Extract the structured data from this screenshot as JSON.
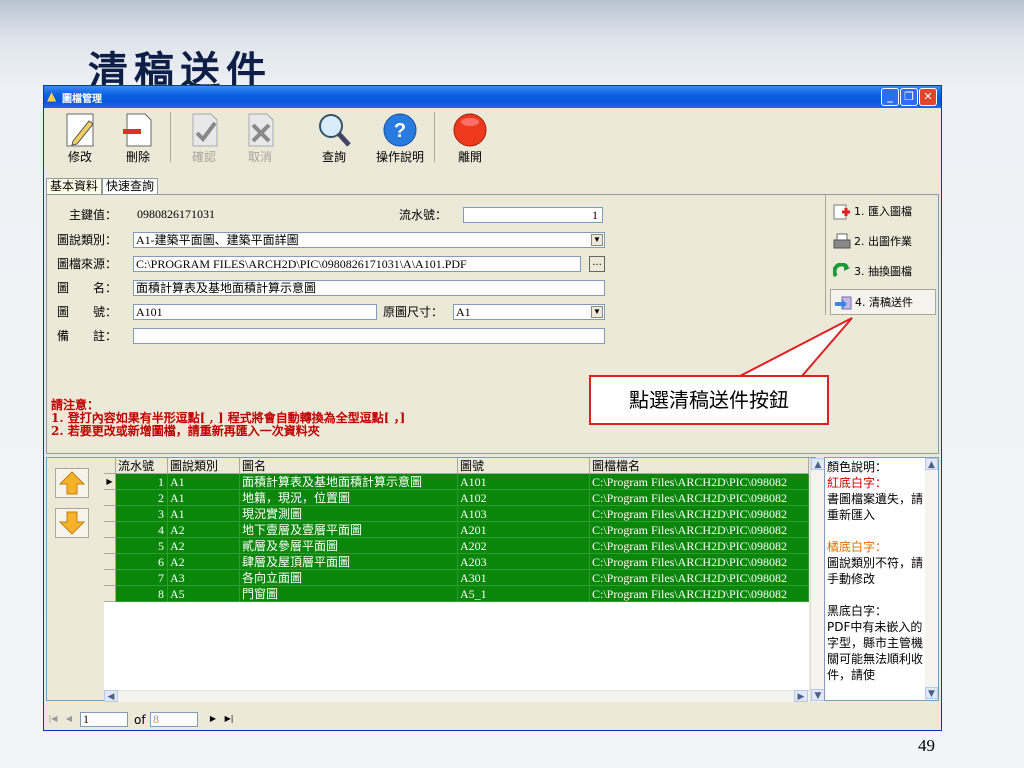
{
  "slide": {
    "title": "清稿送件",
    "page_number": "49"
  },
  "window": {
    "title": "圖檔管理"
  },
  "toolbar": {
    "buttons": [
      {
        "label": "修改",
        "icon": "pencil-icon",
        "enabled": true
      },
      {
        "label": "刪除",
        "icon": "delete-doc-icon",
        "enabled": true
      },
      {
        "label": "確認",
        "icon": "confirm-icon",
        "enabled": false
      },
      {
        "label": "取消",
        "icon": "cancel-icon",
        "enabled": false
      },
      {
        "label": "查詢",
        "icon": "magnifier-icon",
        "enabled": true
      },
      {
        "label": "操作說明",
        "icon": "help-icon",
        "enabled": true
      },
      {
        "label": "離開",
        "icon": "exit-icon",
        "enabled": true
      }
    ]
  },
  "tabs": [
    "基本資料",
    "快速查詢"
  ],
  "form": {
    "key_label": "主鍵值：",
    "key_value": "0980826171031",
    "serial_label": "流水號：",
    "serial_value": "1",
    "category_label": "圖說類別：",
    "category_value": "A1-建築平面圖、建築平面詳圖",
    "source_label": "圖檔來源：",
    "source_value": "C:\\PROGRAM FILES\\ARCH2D\\PIC\\0980826171031\\A\\A101.PDF",
    "name_label": "圖　　名：",
    "name_value": "面積計算表及基地面積計算示意圖",
    "number_label": "圖　　號：",
    "number_value": "A101",
    "size_label": "原圖尺寸：",
    "size_value": "A1",
    "note_label": "備　　註：",
    "note_value": ""
  },
  "notice": {
    "line1": "請注意：",
    "line2": "1. 登打內容如果有半形逗點[ , ]   程式將會自動轉換為全型逗點[ ，]",
    "line3": "2. 若要更改或新增圖檔，請重新再匯入一次資料夾"
  },
  "side_buttons": [
    {
      "label": "1. 匯入圖檔",
      "icon": "import-icon"
    },
    {
      "label": "2. 出圖作業",
      "icon": "printer-icon"
    },
    {
      "label": "3. 抽換圖檔",
      "icon": "swap-icon"
    },
    {
      "label": "4. 清稿送件",
      "icon": "send-icon"
    }
  ],
  "callout": {
    "text": "點選清稿送件按鈕"
  },
  "grid": {
    "headers": [
      "流水號",
      "圖說類別",
      "圖名",
      "圖號",
      "圖檔檔名"
    ],
    "rows": [
      [
        "1",
        "A1",
        "面積計算表及基地面積計算示意圖",
        "A101",
        "C:\\Program Files\\ARCH2D\\PIC\\098082"
      ],
      [
        "2",
        "A1",
        "地籍，現況，位置圖",
        "A102",
        "C:\\Program Files\\ARCH2D\\PIC\\098082"
      ],
      [
        "3",
        "A1",
        "現況實測圖",
        "A103",
        "C:\\Program Files\\ARCH2D\\PIC\\098082"
      ],
      [
        "4",
        "A2",
        "地下壹層及壹層平面圖",
        "A201",
        "C:\\Program Files\\ARCH2D\\PIC\\098082"
      ],
      [
        "5",
        "A2",
        "貳層及參層平面圖",
        "A202",
        "C:\\Program Files\\ARCH2D\\PIC\\098082"
      ],
      [
        "6",
        "A2",
        "肆層及屋頂層平面圖",
        "A203",
        "C:\\Program Files\\ARCH2D\\PIC\\098082"
      ],
      [
        "7",
        "A3",
        "各向立面圖",
        "A301",
        "C:\\Program Files\\ARCH2D\\PIC\\098082"
      ],
      [
        "8",
        "A5",
        "門窗圖",
        "A5_1",
        "C:\\Program Files\\ARCH2D\\PIC\\098082"
      ]
    ]
  },
  "legend": {
    "title": "顏色說明：",
    "red_title": "紅底白字：",
    "red_text": "書圖檔案遺失，請重新匯入",
    "orange_title": "橘底白字：",
    "orange_text": "圖說類別不符，請手動修改",
    "black_title": "黑底白字：",
    "black_text": "PDF中有未嵌入的字型，縣市主管機關可能無法順利收件，請使"
  },
  "navigator": {
    "position": "1",
    "of_label": "of",
    "total": "8"
  },
  "colors": {
    "row_bg": "#0a870a",
    "notice": "#c00000",
    "callout_border": "#e02020",
    "titlebar": "#0855dd"
  }
}
